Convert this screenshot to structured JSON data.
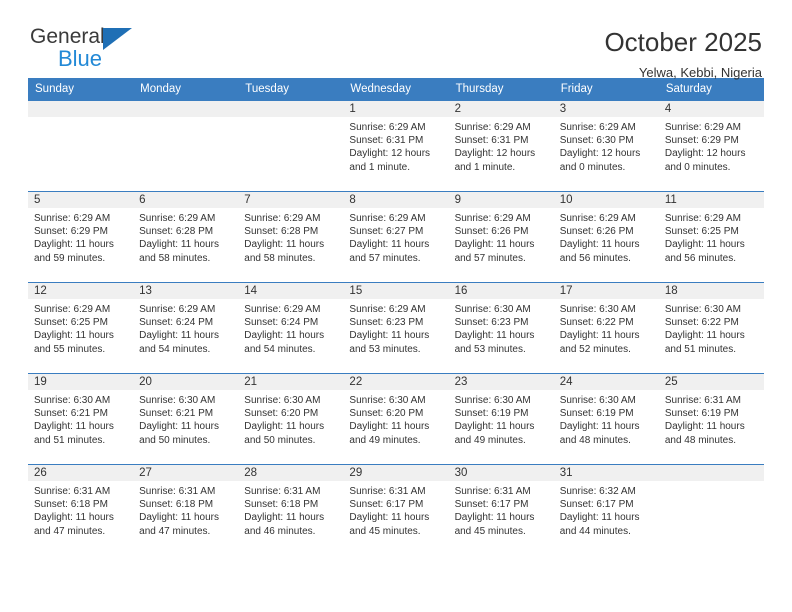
{
  "brand": {
    "name_part1": "General",
    "name_part2": "Blue",
    "triangle_color": "#1f6fb5",
    "blue_color": "#2389d6"
  },
  "header": {
    "title": "October 2025",
    "location": "Yelwa, Kebbi, Nigeria"
  },
  "theme": {
    "header_blue": "#3a7dc0",
    "band_gray": "#f0f0f0",
    "text": "#333333"
  },
  "weekday_headers": [
    "Sunday",
    "Monday",
    "Tuesday",
    "Wednesday",
    "Thursday",
    "Friday",
    "Saturday"
  ],
  "weeks": [
    [
      {
        "day": "",
        "sunrise": "",
        "sunset": "",
        "daylight1": "",
        "daylight2": ""
      },
      {
        "day": "",
        "sunrise": "",
        "sunset": "",
        "daylight1": "",
        "daylight2": ""
      },
      {
        "day": "",
        "sunrise": "",
        "sunset": "",
        "daylight1": "",
        "daylight2": ""
      },
      {
        "day": "1",
        "sunrise": "Sunrise: 6:29 AM",
        "sunset": "Sunset: 6:31 PM",
        "daylight1": "Daylight: 12 hours",
        "daylight2": "and 1 minute."
      },
      {
        "day": "2",
        "sunrise": "Sunrise: 6:29 AM",
        "sunset": "Sunset: 6:31 PM",
        "daylight1": "Daylight: 12 hours",
        "daylight2": "and 1 minute."
      },
      {
        "day": "3",
        "sunrise": "Sunrise: 6:29 AM",
        "sunset": "Sunset: 6:30 PM",
        "daylight1": "Daylight: 12 hours",
        "daylight2": "and 0 minutes."
      },
      {
        "day": "4",
        "sunrise": "Sunrise: 6:29 AM",
        "sunset": "Sunset: 6:29 PM",
        "daylight1": "Daylight: 12 hours",
        "daylight2": "and 0 minutes."
      }
    ],
    [
      {
        "day": "5",
        "sunrise": "Sunrise: 6:29 AM",
        "sunset": "Sunset: 6:29 PM",
        "daylight1": "Daylight: 11 hours",
        "daylight2": "and 59 minutes."
      },
      {
        "day": "6",
        "sunrise": "Sunrise: 6:29 AM",
        "sunset": "Sunset: 6:28 PM",
        "daylight1": "Daylight: 11 hours",
        "daylight2": "and 58 minutes."
      },
      {
        "day": "7",
        "sunrise": "Sunrise: 6:29 AM",
        "sunset": "Sunset: 6:28 PM",
        "daylight1": "Daylight: 11 hours",
        "daylight2": "and 58 minutes."
      },
      {
        "day": "8",
        "sunrise": "Sunrise: 6:29 AM",
        "sunset": "Sunset: 6:27 PM",
        "daylight1": "Daylight: 11 hours",
        "daylight2": "and 57 minutes."
      },
      {
        "day": "9",
        "sunrise": "Sunrise: 6:29 AM",
        "sunset": "Sunset: 6:26 PM",
        "daylight1": "Daylight: 11 hours",
        "daylight2": "and 57 minutes."
      },
      {
        "day": "10",
        "sunrise": "Sunrise: 6:29 AM",
        "sunset": "Sunset: 6:26 PM",
        "daylight1": "Daylight: 11 hours",
        "daylight2": "and 56 minutes."
      },
      {
        "day": "11",
        "sunrise": "Sunrise: 6:29 AM",
        "sunset": "Sunset: 6:25 PM",
        "daylight1": "Daylight: 11 hours",
        "daylight2": "and 56 minutes."
      }
    ],
    [
      {
        "day": "12",
        "sunrise": "Sunrise: 6:29 AM",
        "sunset": "Sunset: 6:25 PM",
        "daylight1": "Daylight: 11 hours",
        "daylight2": "and 55 minutes."
      },
      {
        "day": "13",
        "sunrise": "Sunrise: 6:29 AM",
        "sunset": "Sunset: 6:24 PM",
        "daylight1": "Daylight: 11 hours",
        "daylight2": "and 54 minutes."
      },
      {
        "day": "14",
        "sunrise": "Sunrise: 6:29 AM",
        "sunset": "Sunset: 6:24 PM",
        "daylight1": "Daylight: 11 hours",
        "daylight2": "and 54 minutes."
      },
      {
        "day": "15",
        "sunrise": "Sunrise: 6:29 AM",
        "sunset": "Sunset: 6:23 PM",
        "daylight1": "Daylight: 11 hours",
        "daylight2": "and 53 minutes."
      },
      {
        "day": "16",
        "sunrise": "Sunrise: 6:30 AM",
        "sunset": "Sunset: 6:23 PM",
        "daylight1": "Daylight: 11 hours",
        "daylight2": "and 53 minutes."
      },
      {
        "day": "17",
        "sunrise": "Sunrise: 6:30 AM",
        "sunset": "Sunset: 6:22 PM",
        "daylight1": "Daylight: 11 hours",
        "daylight2": "and 52 minutes."
      },
      {
        "day": "18",
        "sunrise": "Sunrise: 6:30 AM",
        "sunset": "Sunset: 6:22 PM",
        "daylight1": "Daylight: 11 hours",
        "daylight2": "and 51 minutes."
      }
    ],
    [
      {
        "day": "19",
        "sunrise": "Sunrise: 6:30 AM",
        "sunset": "Sunset: 6:21 PM",
        "daylight1": "Daylight: 11 hours",
        "daylight2": "and 51 minutes."
      },
      {
        "day": "20",
        "sunrise": "Sunrise: 6:30 AM",
        "sunset": "Sunset: 6:21 PM",
        "daylight1": "Daylight: 11 hours",
        "daylight2": "and 50 minutes."
      },
      {
        "day": "21",
        "sunrise": "Sunrise: 6:30 AM",
        "sunset": "Sunset: 6:20 PM",
        "daylight1": "Daylight: 11 hours",
        "daylight2": "and 50 minutes."
      },
      {
        "day": "22",
        "sunrise": "Sunrise: 6:30 AM",
        "sunset": "Sunset: 6:20 PM",
        "daylight1": "Daylight: 11 hours",
        "daylight2": "and 49 minutes."
      },
      {
        "day": "23",
        "sunrise": "Sunrise: 6:30 AM",
        "sunset": "Sunset: 6:19 PM",
        "daylight1": "Daylight: 11 hours",
        "daylight2": "and 49 minutes."
      },
      {
        "day": "24",
        "sunrise": "Sunrise: 6:30 AM",
        "sunset": "Sunset: 6:19 PM",
        "daylight1": "Daylight: 11 hours",
        "daylight2": "and 48 minutes."
      },
      {
        "day": "25",
        "sunrise": "Sunrise: 6:31 AM",
        "sunset": "Sunset: 6:19 PM",
        "daylight1": "Daylight: 11 hours",
        "daylight2": "and 48 minutes."
      }
    ],
    [
      {
        "day": "26",
        "sunrise": "Sunrise: 6:31 AM",
        "sunset": "Sunset: 6:18 PM",
        "daylight1": "Daylight: 11 hours",
        "daylight2": "and 47 minutes."
      },
      {
        "day": "27",
        "sunrise": "Sunrise: 6:31 AM",
        "sunset": "Sunset: 6:18 PM",
        "daylight1": "Daylight: 11 hours",
        "daylight2": "and 47 minutes."
      },
      {
        "day": "28",
        "sunrise": "Sunrise: 6:31 AM",
        "sunset": "Sunset: 6:18 PM",
        "daylight1": "Daylight: 11 hours",
        "daylight2": "and 46 minutes."
      },
      {
        "day": "29",
        "sunrise": "Sunrise: 6:31 AM",
        "sunset": "Sunset: 6:17 PM",
        "daylight1": "Daylight: 11 hours",
        "daylight2": "and 45 minutes."
      },
      {
        "day": "30",
        "sunrise": "Sunrise: 6:31 AM",
        "sunset": "Sunset: 6:17 PM",
        "daylight1": "Daylight: 11 hours",
        "daylight2": "and 45 minutes."
      },
      {
        "day": "31",
        "sunrise": "Sunrise: 6:32 AM",
        "sunset": "Sunset: 6:17 PM",
        "daylight1": "Daylight: 11 hours",
        "daylight2": "and 44 minutes."
      },
      {
        "day": "",
        "sunrise": "",
        "sunset": "",
        "daylight1": "",
        "daylight2": ""
      }
    ]
  ]
}
